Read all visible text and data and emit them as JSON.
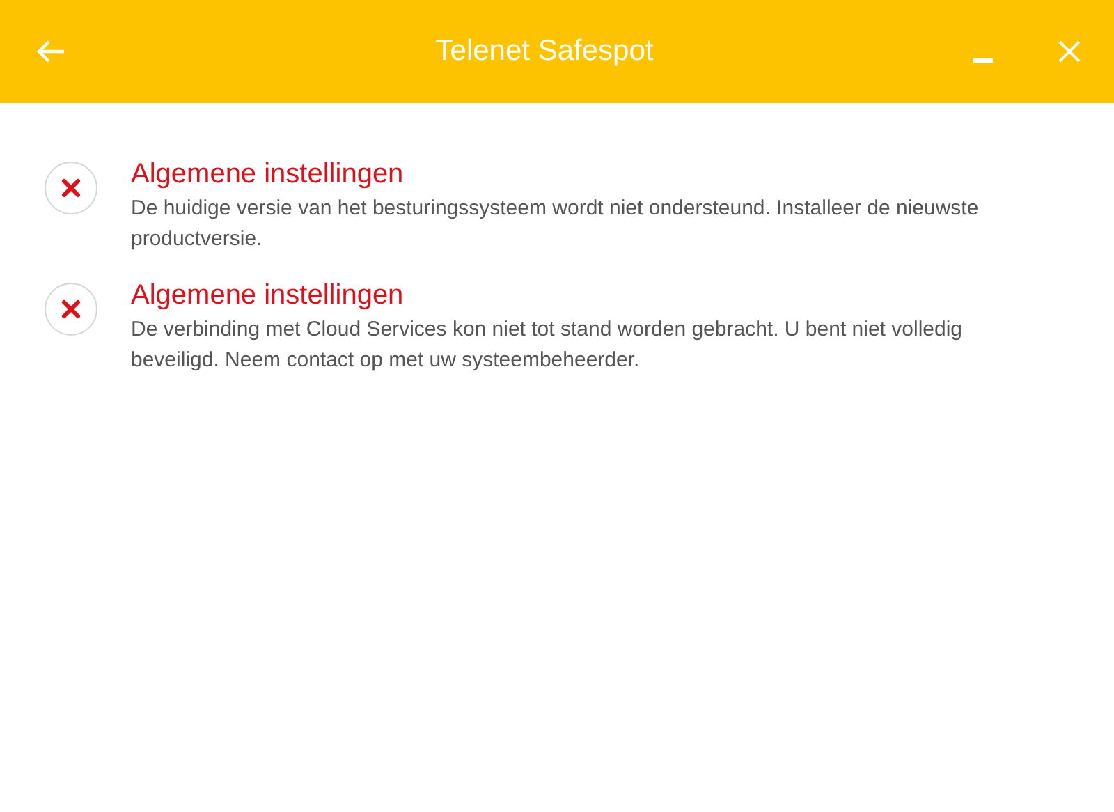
{
  "window": {
    "title": "Telenet Safespot"
  },
  "notifications": [
    {
      "kind": "error",
      "title": "Algemene instellingen",
      "description": "De huidige versie van het besturingssysteem wordt niet ondersteund. Installeer de nieuwste productversie."
    },
    {
      "kind": "error",
      "title": "Algemene instellingen",
      "description": "De verbinding met Cloud Services kon niet tot stand worden gebracht. U bent niet volledig beveiligd. Neem contact op met uw systeembeheerder."
    }
  ]
}
